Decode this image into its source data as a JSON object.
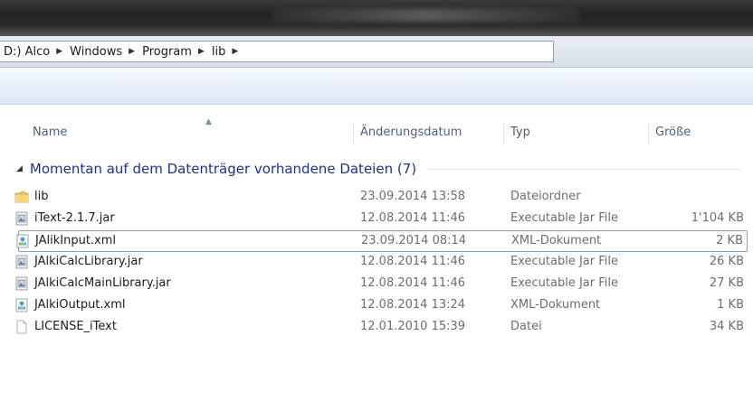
{
  "breadcrumb": {
    "prefix": "D:) Alco",
    "items": [
      "Windows",
      "Program",
      "lib"
    ]
  },
  "columns": {
    "name": "Name",
    "date": "Änderungsdatum",
    "type": "Typ",
    "size": "Größe"
  },
  "group": {
    "label": "Momentan auf dem Datenträger vorhandene Dateien (7)"
  },
  "files": [
    {
      "name": "lib",
      "date": "23.09.2014 13:58",
      "type": "Dateiordner",
      "size": "",
      "icon": "folder-icon"
    },
    {
      "name": "iText-2.1.7.jar",
      "date": "12.08.2014 11:46",
      "type": "Executable Jar File",
      "size": "1'104 KB",
      "icon": "jar-file-icon"
    },
    {
      "name": "JAlikInput.xml",
      "date": "23.09.2014 08:14",
      "type": "XML-Dokument",
      "size": "2 KB",
      "icon": "xml-file-icon"
    },
    {
      "name": "JAlkiCalcLibrary.jar",
      "date": "12.08.2014 11:46",
      "type": "Executable Jar File",
      "size": "26 KB",
      "icon": "jar-file-icon"
    },
    {
      "name": "JAlkiCalcMainLibrary.jar",
      "date": "12.08.2014 11:46",
      "type": "Executable Jar File",
      "size": "27 KB",
      "icon": "jar-file-icon"
    },
    {
      "name": "JAlkiOutput.xml",
      "date": "12.08.2014 13:24",
      "type": "XML-Dokument",
      "size": "1 KB",
      "icon": "xml-file-icon"
    },
    {
      "name": "LICENSE_iText",
      "date": "12.01.2010 15:39",
      "type": "Datei",
      "size": "34 KB",
      "icon": "blank-file-icon"
    }
  ],
  "selected_index": 2,
  "colors": {
    "group_label": "#1e3287",
    "selection_border": "#7da2ce",
    "header_text": "#4c607a"
  }
}
